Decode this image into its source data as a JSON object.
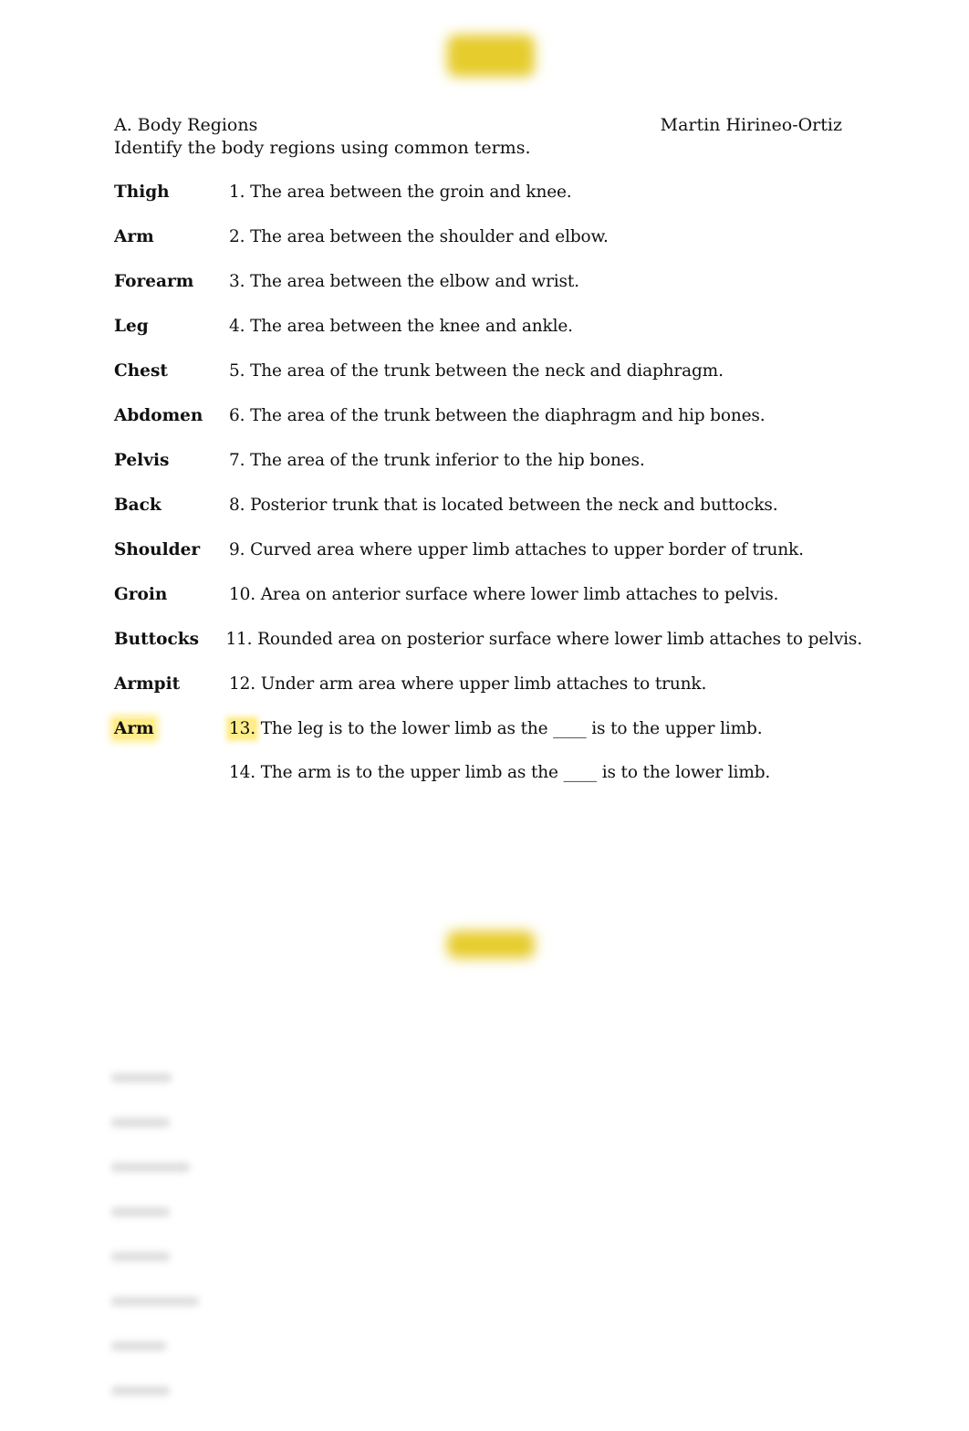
{
  "page_marks": {
    "top": "blurred highlighted page number",
    "bottom": "blurred highlighted page number"
  },
  "header": {
    "section_title": "A. Body Regions",
    "author": "Martin Hirineo-Ortiz",
    "instructions": "Identify the body regions using common terms."
  },
  "highlight_color": "#ffed8a",
  "items": [
    {
      "answer": "Thigh",
      "number": "1.",
      "text": " The area between the groin and knee."
    },
    {
      "answer": "Arm",
      "number": "2.",
      "text": " The area between the shoulder and elbow."
    },
    {
      "answer": "Forearm",
      "number": "3.",
      "text": " The area between the elbow and wrist."
    },
    {
      "answer": "Leg",
      "number": "4.",
      "text": " The area between the knee and ankle."
    },
    {
      "answer": "Chest",
      "number": "5.",
      "text": " The area of the trunk between the neck and diaphragm."
    },
    {
      "answer": "Abdomen",
      "number": "6.",
      "text": " The area of the trunk between the diaphragm and hip bones."
    },
    {
      "answer": "Pelvis",
      "number": "7.",
      "text": " The area of the trunk inferior to the hip bones."
    },
    {
      "answer": "Back",
      "number": "8.",
      "text": " Posterior trunk that is located between the neck and buttocks."
    },
    {
      "answer": "Shoulder",
      "number": "9.",
      "text": " Curved area where upper limb attaches to upper border of trunk."
    },
    {
      "answer": "Groin",
      "number": "10.",
      "text": " Area on anterior surface where lower limb attaches to pelvis."
    },
    {
      "answer": "Buttocks",
      "number": "11.",
      "text": " Rounded area on posterior surface where lower limb attaches to pelvis."
    },
    {
      "answer": "Armpit",
      "number": "12.",
      "text": " Under arm area where upper limb attaches to trunk."
    },
    {
      "answer": "Arm",
      "number": "13.",
      "text": " The leg is to the lower limb as the ____ is to the upper limb.",
      "highlighted": true
    },
    {
      "answer": "",
      "number": "14.",
      "text": " The arm is to the upper limb as the ____ is to the lower limb."
    }
  ],
  "blurred_answers_count": 8
}
